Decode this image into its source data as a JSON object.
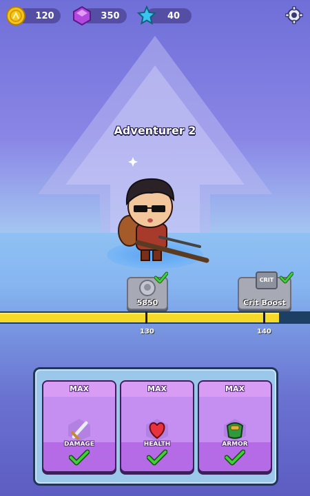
{
  "resources": [
    {
      "icon": "coin-icon",
      "value": "120",
      "color": "#f5c518"
    },
    {
      "icon": "gem-icon",
      "value": "350",
      "color": "#b248e0"
    },
    {
      "icon": "star-icon",
      "value": "40",
      "color": "#38c6f0"
    }
  ],
  "settings_icon": "gear-icon",
  "character": {
    "name": "Adventurer 2"
  },
  "rewards": [
    {
      "label": "5850",
      "icon": "skull-coin-icon",
      "claimed": true
    },
    {
      "label": "Crit Boost",
      "icon_text": "CRIT",
      "claimed": true
    }
  ],
  "progress": {
    "fill_fraction": 0.9,
    "ticks": [
      "130",
      "140"
    ]
  },
  "upgrades": [
    {
      "level": "MAX",
      "label": "DAMAGE",
      "icon": "sword-icon",
      "done": true
    },
    {
      "level": "MAX",
      "label": "HEALTH",
      "icon": "heart-icon",
      "done": true
    },
    {
      "level": "MAX",
      "label": "ARMOR",
      "icon": "armor-icon",
      "done": true
    }
  ],
  "colors": {
    "progress_fill": "#f6da2a",
    "card": "#b56be6",
    "check": "#3fcf3a"
  }
}
